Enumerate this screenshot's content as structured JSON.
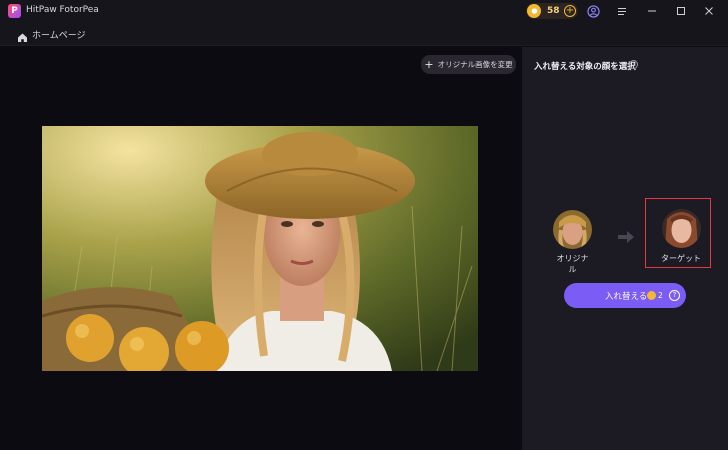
{
  "app": {
    "title": "HitPaw FotorPea",
    "logo_letter": "P"
  },
  "titlebar": {
    "credits": "58",
    "credit_add": "+",
    "icons": [
      "account-icon",
      "menu-icon",
      "minimize-icon",
      "maximize-icon",
      "close-icon"
    ]
  },
  "nav": {
    "home_label": "ホームページ"
  },
  "canvas": {
    "change_button_label": "オリジナル画像を変更",
    "change_button_icon": "+"
  },
  "panel": {
    "title": "入れ替える対象の顔を選択",
    "info": "i",
    "original_label": "オリジナル",
    "target_label": "ターゲット",
    "swap_button_label": "入れ替える",
    "swap_cost": "2",
    "swap_help": "?"
  },
  "colors": {
    "accent": "#7b5cf5",
    "coin": "#f2b733",
    "selection": "#e03a3a",
    "background": "#0d0b12",
    "panel": "#1c1a22"
  }
}
